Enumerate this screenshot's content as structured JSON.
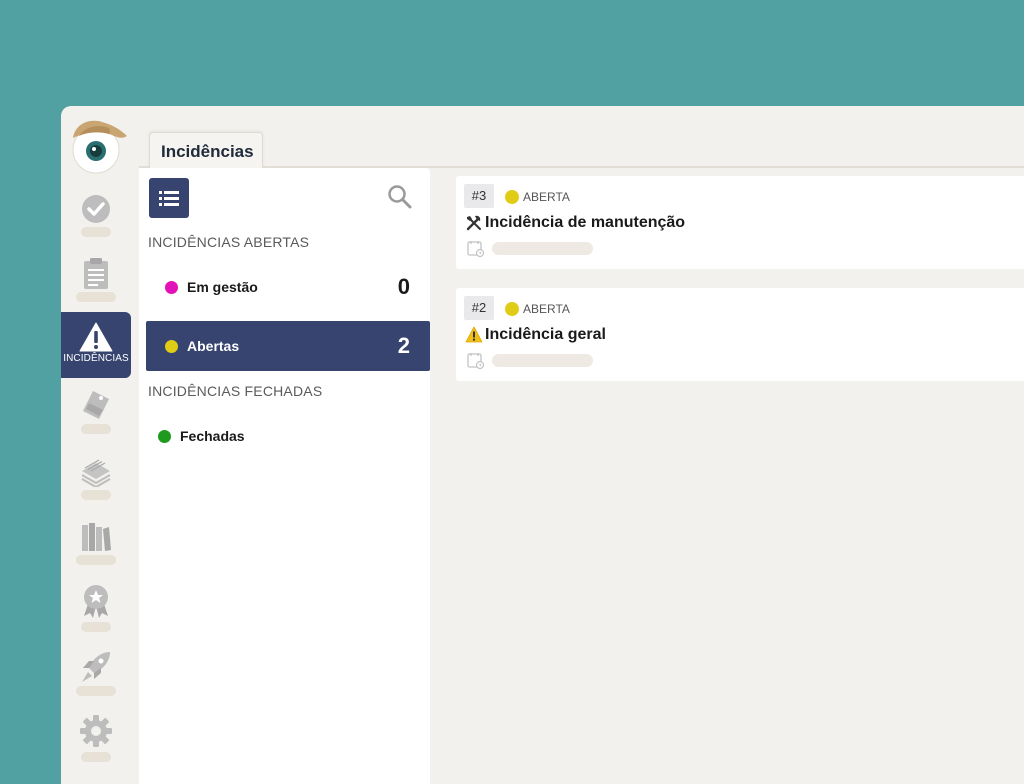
{
  "sidebar": {
    "items": [
      {
        "icon": "check-circle-icon"
      },
      {
        "icon": "clipboard-icon"
      },
      {
        "icon": "warning-icon",
        "label": "INCIDÊNCIAS",
        "active": true
      },
      {
        "icon": "tag-icon"
      },
      {
        "icon": "documents-stack-icon"
      },
      {
        "icon": "books-icon"
      },
      {
        "icon": "award-ribbon-icon"
      },
      {
        "icon": "rocket-icon"
      },
      {
        "icon": "gear-icon"
      }
    ]
  },
  "header": {
    "tab_label": "Incidências"
  },
  "list_panel": {
    "open_section_title": "INCIDÊNCIAS ABERTAS",
    "closed_section_title": "INCIDÊNCIAS FECHADAS",
    "open_items": [
      {
        "label": "Em gestão",
        "count": "0",
        "dot_color": "#e312b8"
      },
      {
        "label": "Abertas",
        "count": "2",
        "dot_color": "#e0cc14",
        "active": true
      }
    ],
    "closed_items": [
      {
        "label": "Fechadas",
        "dot_color": "#1e9a1e"
      }
    ]
  },
  "incidents": [
    {
      "number": "#3",
      "status": "ABERTA",
      "status_color": "#e0cc14",
      "icon": "tools-icon",
      "title": "Incidência de manutenção"
    },
    {
      "number": "#2",
      "status": "ABERTA",
      "status_color": "#e0cc14",
      "icon": "warning-icon",
      "title": "Incidência geral"
    }
  ],
  "colors": {
    "background": "#51a0a2",
    "app_bg": "#f2f1ed",
    "accent": "#36446f"
  }
}
